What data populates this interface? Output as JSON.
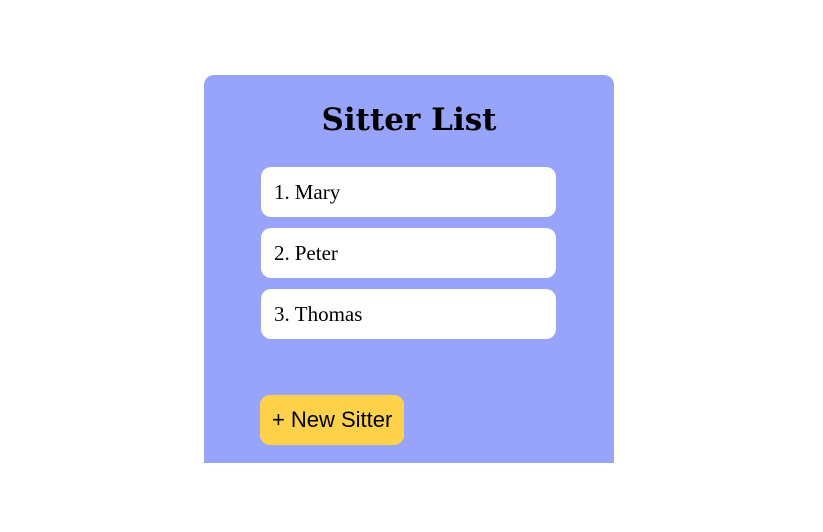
{
  "panel": {
    "title": "Sitter List"
  },
  "sitters": [
    {
      "number": "1.",
      "name": "Mary"
    },
    {
      "number": "2.",
      "name": "Peter"
    },
    {
      "number": "3.",
      "name": "Thomas"
    }
  ],
  "new_button": {
    "icon": "plus-icon",
    "icon_glyph": "+",
    "label": "New Sitter"
  },
  "colors": {
    "panel_background": "#97a4fa",
    "item_background": "#ffffff",
    "button_background": "#fdd24a"
  }
}
